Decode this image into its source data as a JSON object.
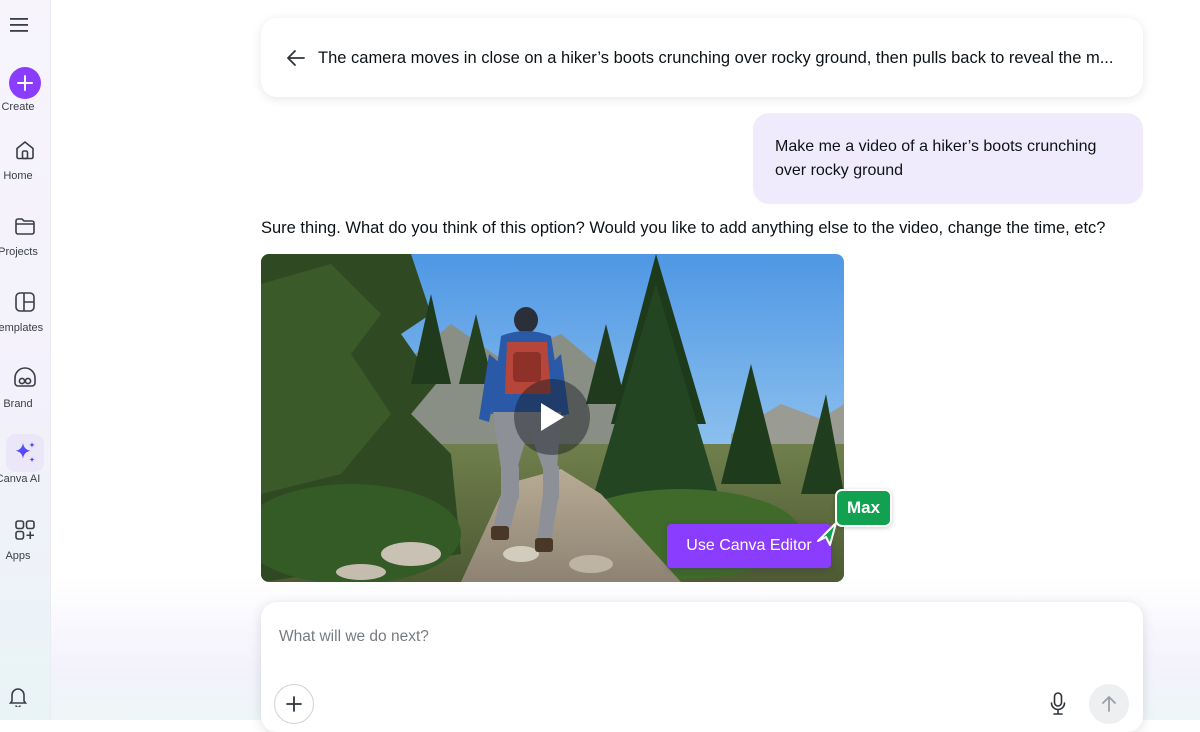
{
  "sidebar": {
    "items": [
      {
        "label": "Create",
        "icon": "plus-icon"
      },
      {
        "label": "Home",
        "icon": "home-icon"
      },
      {
        "label": "Projects",
        "icon": "folder-icon"
      },
      {
        "label": "Templates",
        "icon": "templates-icon"
      },
      {
        "label": "Brand",
        "icon": "brand-icon"
      },
      {
        "label": "Canva AI",
        "icon": "sparkle-icon"
      },
      {
        "label": "Apps",
        "icon": "apps-icon"
      }
    ],
    "active": "Canva AI"
  },
  "conversation": {
    "prompt_title": "The camera moves in close on a hiker’s boots crunching over rocky ground, then pulls back to reveal the m...",
    "user_message": {
      "line1": "Make me a video of a hiker’s boots crunching",
      "line2": "over rocky ground"
    },
    "assistant_message": "Sure thing. What do you think of this option? Would you like to add anything else to the video, change the time, etc?",
    "video": {
      "editor_button_label": "Use Canva Editor",
      "cursor_name": "Max"
    }
  },
  "composer": {
    "placeholder": "What will we do next?"
  },
  "colors": {
    "accent": "#8b3dff",
    "cursor_tag": "#12a150",
    "user_bubble": "#f0ebfc"
  }
}
